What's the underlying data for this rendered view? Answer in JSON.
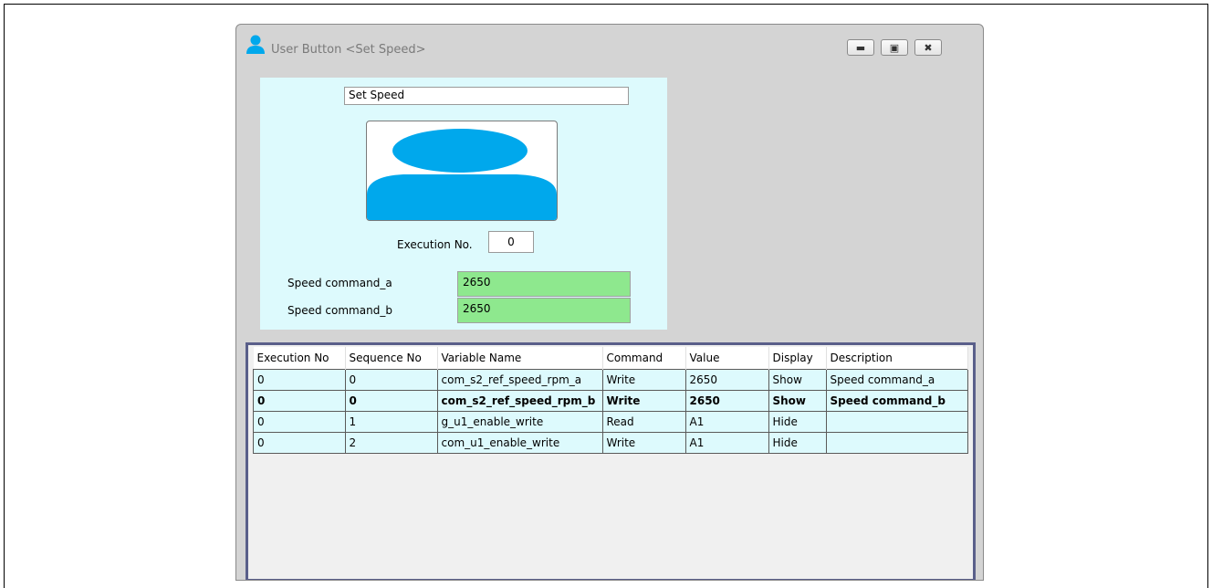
{
  "window": {
    "title": "User Button <Set Speed>",
    "icon": "user-icon",
    "controls": [
      "minimize-icon",
      "restore-icon",
      "close-icon"
    ]
  },
  "form": {
    "button_name": "Set Speed",
    "image": "user-silhouette-icon",
    "execution_label": "Execution No.",
    "execution_value": "0",
    "params": [
      {
        "label": "Speed command_a",
        "value": "2650"
      },
      {
        "label": "Speed command_b",
        "value": "2650"
      }
    ]
  },
  "grid": {
    "columns": [
      "Execution No",
      "Sequence No",
      "Variable Name",
      "Command",
      "Value",
      "Display",
      "Description"
    ],
    "rows": [
      [
        "0",
        "0",
        "com_s2_ref_speed_rpm_a",
        "Write",
        "2650",
        "Show",
        "Speed command_a"
      ],
      [
        "0",
        "0",
        "com_s2_ref_speed_rpm_b",
        "Write",
        "2650",
        "Show",
        "Speed command_b"
      ],
      [
        "0",
        "1",
        "g_u1_enable_write",
        "Read",
        "A1",
        "Hide",
        ""
      ],
      [
        "0",
        "2",
        "com_u1_enable_write",
        "Write",
        "A1",
        "Hide",
        ""
      ]
    ],
    "selected_row": 1
  },
  "colors": {
    "panel_bg": "#ddfafd",
    "value_bg": "#8ee88e",
    "icon_blue": "#00a8ec",
    "grid_border": "#5a5f8a"
  }
}
